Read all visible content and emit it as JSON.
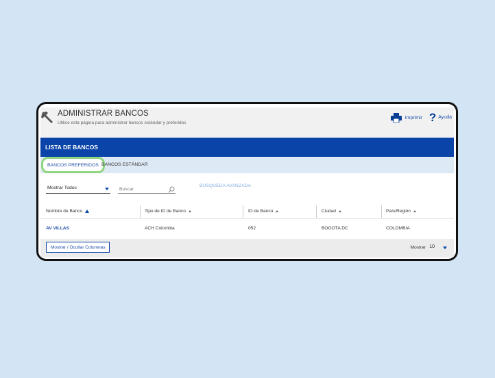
{
  "header": {
    "title": "ADMINISTRAR BANCOS",
    "subtitle": "Utilice esta página para administrar bancos estándar y preferidos",
    "print_label": "Imprimir",
    "help_label": "Ayuda",
    "icons": {
      "tool": "tools-icon",
      "print": "printer-icon",
      "help": "question-icon"
    }
  },
  "band": {
    "label": "LISTA DE BANCOS"
  },
  "tabs": [
    {
      "label": "BANCOS PREFERIDOS",
      "active": true
    },
    {
      "label": "BANCOS ESTÁNDAR",
      "active": false
    }
  ],
  "filters": {
    "show_select": "Mostrar Todos",
    "search_placeholder": "Buscar",
    "advanced_search": "BÚSQUEDA AVANZADA"
  },
  "table": {
    "columns": [
      "Nombre de Banco",
      "Tipo de ID de Banco",
      "ID de Banco",
      "Ciudad",
      "País/Región"
    ],
    "rows": [
      [
        "AV VILLAS",
        "ACH Colombia",
        "052",
        "BOGOTA DC",
        "COLOMBIA"
      ]
    ]
  },
  "footer": {
    "columns_button": "Mostrar / Ocultar Columnas",
    "show_label": "Mostrar",
    "show_value": "10"
  },
  "colors": {
    "accent": "#0a44a8",
    "page_bg": "#d3e4f4",
    "highlight": "#8ed57f"
  }
}
